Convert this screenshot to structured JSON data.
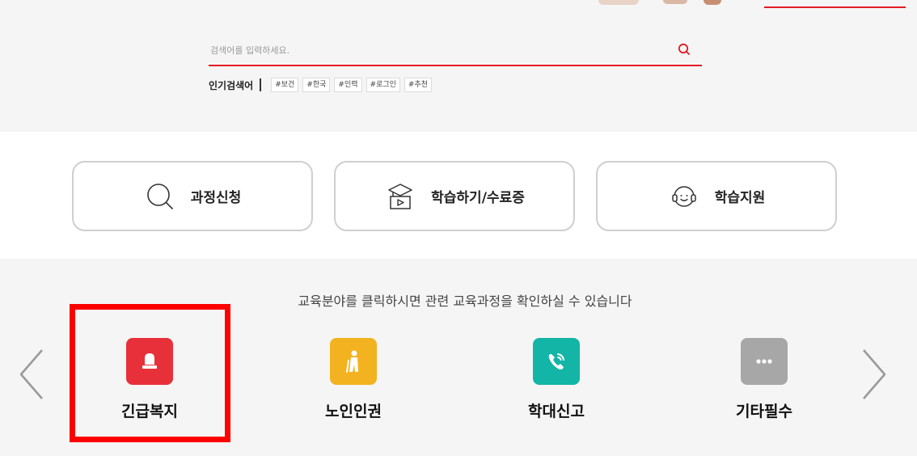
{
  "search": {
    "placeholder": "검색어를 입력하세요.",
    "value": ""
  },
  "popular": {
    "label": "인기검색어",
    "tags": [
      "#보건",
      "#한국",
      "#인력",
      "#로그인",
      "#추천"
    ]
  },
  "quick_menu": [
    {
      "label": "과정신청",
      "icon": "search-icon"
    },
    {
      "label": "학습하기/수료증",
      "icon": "graduation-play-icon"
    },
    {
      "label": "학습지원",
      "icon": "headset-icon"
    }
  ],
  "categories": {
    "description": "교육분야를 클릭하시면 관련 교육과정을 확인하실 수 있습니다",
    "items": [
      {
        "label": "긴급복지",
        "icon": "alarm-bell-icon",
        "color": "#e8303a"
      },
      {
        "label": "노인인권",
        "icon": "elderly-person-icon",
        "color": "#f3b320"
      },
      {
        "label": "학대신고",
        "icon": "phone-call-icon",
        "color": "#12b5a6"
      },
      {
        "label": "기타필수",
        "icon": "more-dots-icon",
        "color": "#a7a7a7"
      }
    ]
  },
  "colors": {
    "accent": "#e31b23",
    "highlight": "#ff0000",
    "band_background": "#f5f5f5"
  }
}
